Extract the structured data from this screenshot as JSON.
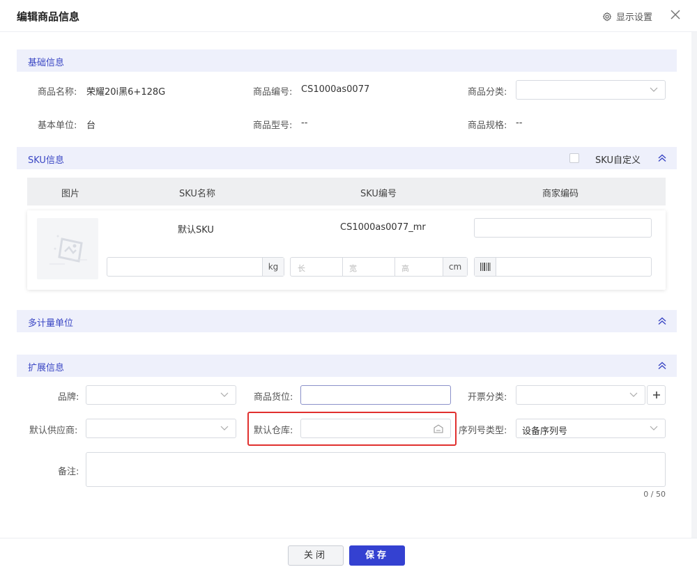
{
  "header": {
    "title": "编辑商品信息",
    "display_settings": "显示设置"
  },
  "basic": {
    "section_title": "基础信息",
    "name_label": "商品名称:",
    "name_value": "荣耀20i黑6+128G",
    "code_label": "商品编号:",
    "code_value": "CS1000as0077",
    "category_label": "商品分类:",
    "unit_label": "基本单位:",
    "unit_value": "台",
    "model_label": "商品型号:",
    "model_value": "--",
    "spec_label": "商品规格:",
    "spec_value": "--"
  },
  "sku": {
    "section_title": "SKU信息",
    "custom_label": "SKU自定义",
    "columns": [
      "图片",
      "SKU名称",
      "SKU编号",
      "商家编码"
    ],
    "row": {
      "name": "默认SKU",
      "code": "CS1000as0077_mr",
      "weight_unit": "kg",
      "length_placeholder": "长",
      "width_placeholder": "宽",
      "height_placeholder": "高",
      "dimension_unit": "cm"
    }
  },
  "multi_unit": {
    "section_title": "多计量单位"
  },
  "extended": {
    "section_title": "扩展信息",
    "brand_label": "品牌:",
    "location_label": "商品货位:",
    "invoice_label": "开票分类:",
    "supplier_label": "默认供应商:",
    "warehouse_label": "默认仓库:",
    "serial_type_label": "序列号类型:",
    "serial_type_value": "设备序列号",
    "remark_label": "备注:",
    "remark_counter": "0 / 50"
  },
  "footer": {
    "close_label": "关闭",
    "save_label": "保存"
  },
  "colors": {
    "accent": "#3441d1",
    "section_bg": "#eef0fb",
    "section_title": "#3b47c4",
    "highlight": "#e0302e"
  }
}
